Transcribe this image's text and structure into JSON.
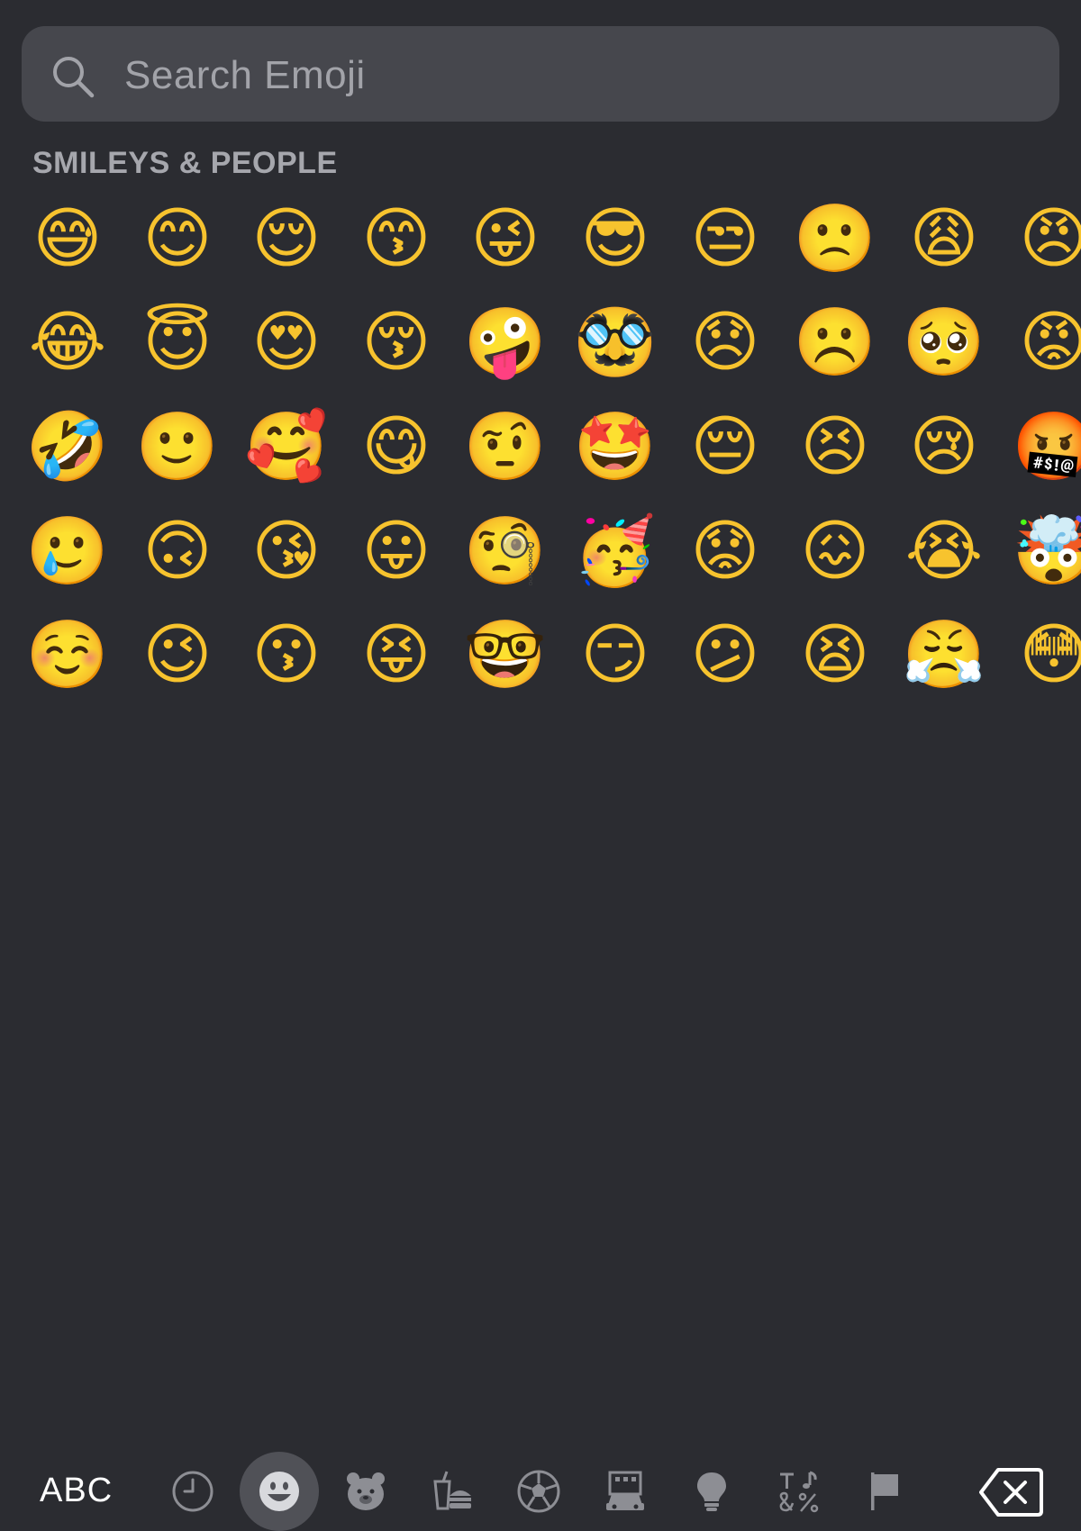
{
  "search": {
    "placeholder": "Search Emoji",
    "icon": "magnifier-icon"
  },
  "section": {
    "title": "SMILEYS & PEOPLE"
  },
  "emoji_rows": [
    [
      "😅",
      "😊",
      "😌",
      "😙",
      "😜",
      "😎",
      "😒",
      "🙁",
      "😩",
      "😠"
    ],
    [
      "😂",
      "😇",
      "😍",
      "😚",
      "🤪",
      "🥸",
      "😞",
      "☹️",
      "🥺",
      "😡"
    ],
    [
      "🤣",
      "🙂",
      "🥰",
      "😋",
      "🤨",
      "🤩",
      "😔",
      "😣",
      "😢",
      "🤬"
    ],
    [
      "🥲",
      "🙃",
      "😘",
      "😛",
      "🧐",
      "🥳",
      "😟",
      "😖",
      "😭",
      "🤯"
    ],
    [
      "☺️",
      "😉",
      "😗",
      "😝",
      "🤓",
      "😏",
      "😕",
      "😫",
      "😤",
      "😳"
    ]
  ],
  "keyboard": {
    "abc_label": "ABC",
    "categories": [
      {
        "name": "recent",
        "icon": "clock-icon"
      },
      {
        "name": "smileys",
        "icon": "smiley-icon",
        "active": true
      },
      {
        "name": "animals",
        "icon": "bear-icon"
      },
      {
        "name": "food",
        "icon": "burger-icon"
      },
      {
        "name": "activity",
        "icon": "soccer-ball-icon"
      },
      {
        "name": "travel",
        "icon": "car-building-icon"
      },
      {
        "name": "objects",
        "icon": "lightbulb-icon"
      },
      {
        "name": "symbols",
        "icon": "symbols-icon"
      },
      {
        "name": "flags",
        "icon": "flag-icon"
      }
    ],
    "delete_icon": "delete-icon"
  },
  "colors": {
    "background": "#2b2c31",
    "search_bg": "#46474d",
    "active_tab": "#505157",
    "emoji_face": "#f7c32e"
  }
}
